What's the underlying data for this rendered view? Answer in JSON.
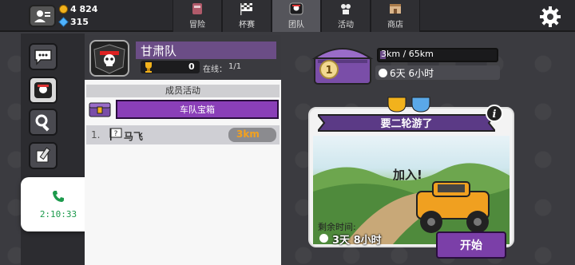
{
  "currency": {
    "coins": "4 824",
    "gems": "315"
  },
  "tabs": [
    {
      "label": "冒险",
      "icon": "adventure-icon",
      "active": false
    },
    {
      "label": "杯赛",
      "icon": "checkered-flag-icon",
      "active": false
    },
    {
      "label": "团队",
      "icon": "team-icon",
      "active": true
    },
    {
      "label": "活动",
      "icon": "events-icon",
      "active": false
    },
    {
      "label": "商店",
      "icon": "shop-icon",
      "active": false
    }
  ],
  "call": {
    "time": "2:10:33"
  },
  "team": {
    "name": "甘肃队",
    "trophies": "0",
    "online_label": "在线：",
    "online_count": "1/1"
  },
  "activity": {
    "title": "成员活动",
    "chest_button": "车队宝箱",
    "members": [
      {
        "rank": "1.",
        "name": "马飞",
        "distance": "3km"
      }
    ]
  },
  "chest": {
    "level": "1",
    "progress_text": "3km / 65km",
    "progress": 0.046,
    "timer": "6天 6小时"
  },
  "event": {
    "title": "要二轮游了",
    "join": "加入!",
    "time_left_label": "剩余时间:",
    "time_left_value": "3天 8小时",
    "start_button": "开始"
  },
  "colors": {
    "accent_purple": "#8a3fb8",
    "dark_purple": "#2a0e3d",
    "orange": "#f4a11d",
    "call_green": "#1c9a4c"
  }
}
